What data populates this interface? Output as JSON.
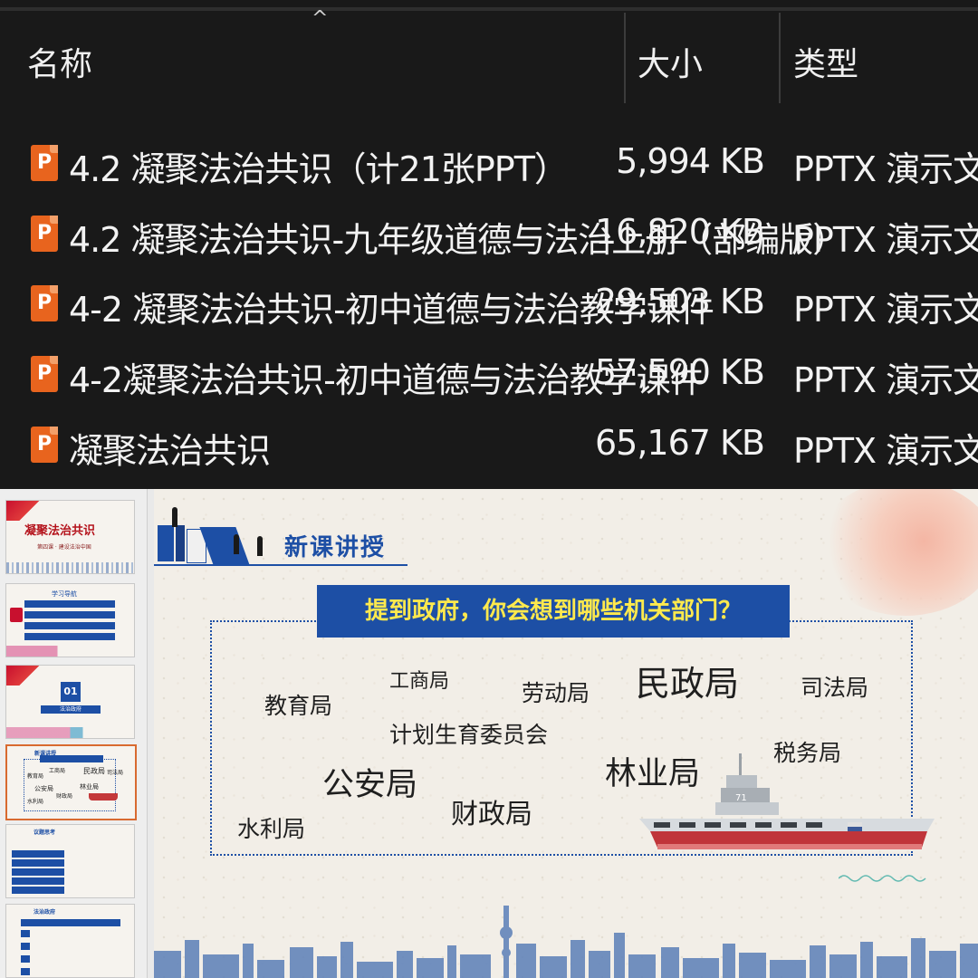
{
  "explorer": {
    "columns": {
      "name": "名称",
      "size": "大小",
      "type": "类型"
    },
    "files": [
      {
        "icon": "powerpoint-file-icon",
        "name": "4.2 凝聚法治共识（计21张PPT）",
        "size": "5,994 KB",
        "type": "PPTX 演示文稿"
      },
      {
        "icon": "powerpoint-file-icon",
        "name": "4.2 凝聚法治共识-九年级道德与法治上册（部编版）",
        "size": "16,820 KB",
        "type": "PPTX 演示文稿"
      },
      {
        "icon": "powerpoint-file-icon",
        "name": "4-2 凝聚法治共识-初中道德与法治教学课件",
        "size": "29,503 KB",
        "type": "PPTX 演示文稿"
      },
      {
        "icon": "powerpoint-file-icon",
        "name": "4-2凝聚法治共识-初中道德与法治教学课件",
        "size": "57,590 KB",
        "type": "PPTX 演示文稿"
      },
      {
        "icon": "powerpoint-file-icon",
        "name": "凝聚法治共识",
        "size": "65,167 KB",
        "type": "PPTX 演示文稿"
      }
    ],
    "icon_letter": "P"
  },
  "thumbnails": {
    "t1": {
      "title": "凝聚法治共识",
      "subtitle": "第四课 · 建设法治中国"
    },
    "t2": {
      "heading": "学习导航"
    },
    "t3": {
      "number": "01",
      "label": "法治政府"
    },
    "t4": {
      "heading": "新课讲授",
      "words": [
        "工商局",
        "民政局",
        "司法局",
        "教育局",
        "公安局",
        "林业局",
        "财政局",
        "水利局"
      ]
    },
    "t5": {
      "heading": "议题思考"
    },
    "t6": {
      "heading": "法治政府"
    }
  },
  "slide": {
    "section_title": "新课讲授",
    "question": "提到政府，你会想到哪些机关部门？",
    "words": [
      "工商局",
      "劳动局",
      "民政局",
      "司法局",
      "教育局",
      "计划生育委员会",
      "税务局",
      "公安局",
      "林业局",
      "财政局",
      "水利局"
    ],
    "ship_number": "71"
  },
  "colors": {
    "explorer_bg": "#191919",
    "file_icon": "#e8641e",
    "slide_blue": "#1d4fa5",
    "question_text": "#ffe94d",
    "selected_thumb_border": "#d86a30"
  }
}
